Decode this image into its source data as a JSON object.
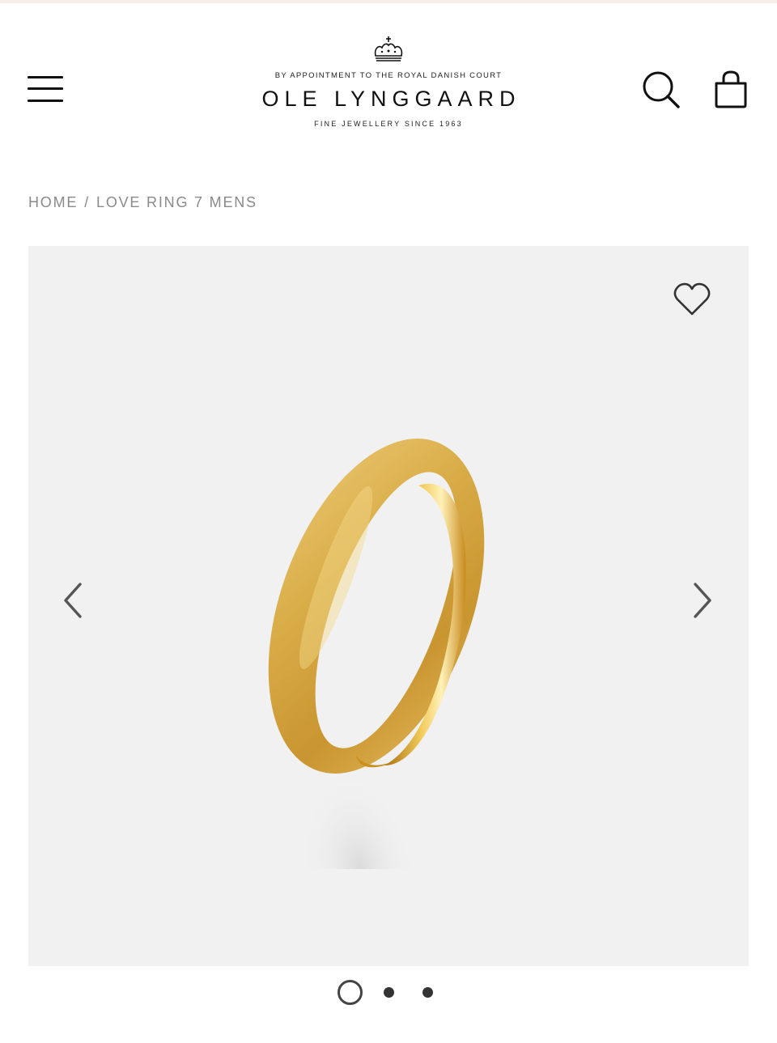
{
  "header": {
    "appointment_text": "BY APPOINTMENT TO THE ROYAL DANISH COURT",
    "brand_name": "OLE LYNGGAARD",
    "tagline": "FINE JEWELLERY SINCE 1963",
    "icons": {
      "menu": "hamburger-menu-icon",
      "logo_crown": "crown-icon",
      "search": "search-icon",
      "bag": "shopping-bag-icon"
    }
  },
  "breadcrumb": {
    "home": "HOME",
    "separator": "/",
    "current": "LOVE RING 7 MENS"
  },
  "gallery": {
    "background_color": "#f1f1f1",
    "product_image": "gold textured ring",
    "icons": {
      "wishlist": "heart-icon",
      "previous": "chevron-left-icon",
      "next": "chevron-right-icon"
    },
    "slide_count": 3,
    "active_slide": 1
  },
  "colors": {
    "text": "#111111",
    "muted": "#8a8a8a",
    "gold": "#d4a635"
  }
}
